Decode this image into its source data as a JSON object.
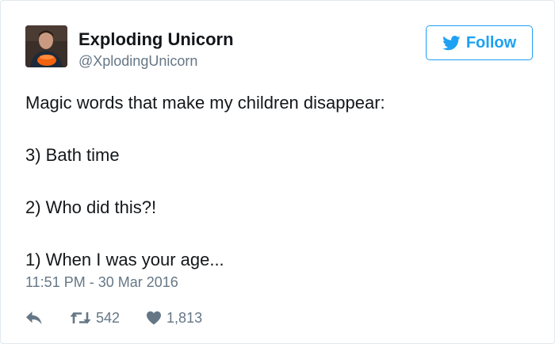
{
  "author": {
    "display_name": "Exploding Unicorn",
    "handle": "@XplodingUnicorn",
    "avatar_icon": "profile-photo"
  },
  "follow_button": {
    "label": "Follow",
    "icon": "twitter-bird-icon",
    "color": "#1da1f2"
  },
  "tweet": {
    "lines": [
      "Magic words that make my children disappear:",
      "",
      "3) Bath time",
      "",
      "2) Who did this?!",
      "",
      "1) When I was your age..."
    ],
    "timestamp": "11:51 PM - 30 Mar 2016"
  },
  "actions": {
    "reply_icon": "reply-icon",
    "retweet_icon": "retweet-icon",
    "retweet_count": "542",
    "like_icon": "heart-icon",
    "like_count": "1,813"
  },
  "colors": {
    "text": "#14171a",
    "secondary": "#657786",
    "accent": "#1da1f2",
    "border": "#e1e8ed"
  }
}
